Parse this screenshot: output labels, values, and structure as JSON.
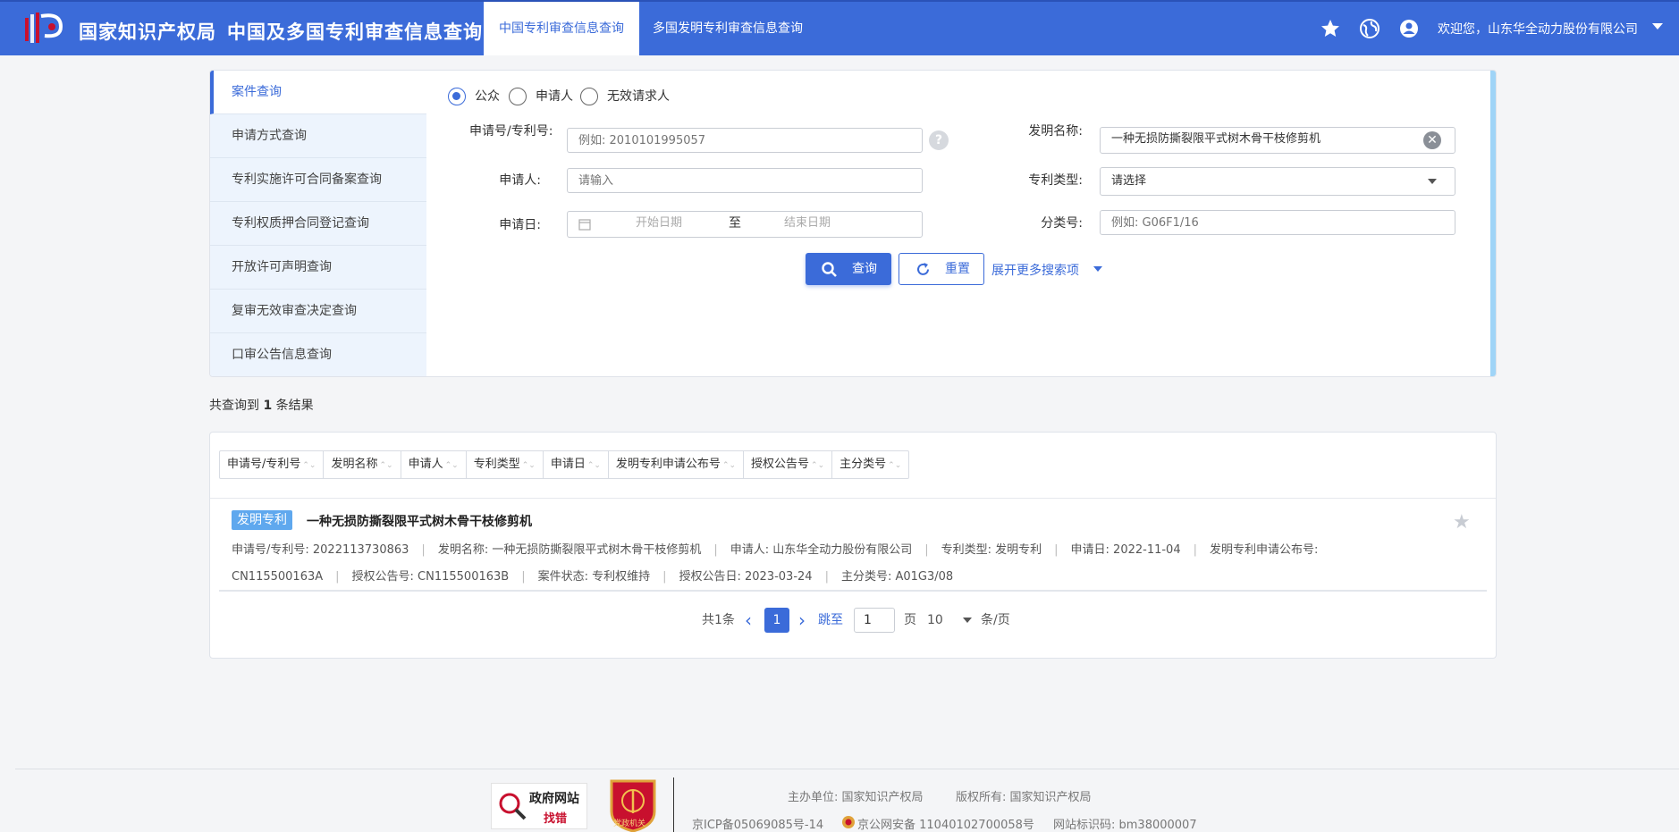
{
  "header": {
    "brand": "国家知识产权局",
    "site_title": "中国及多国专利审查信息查询",
    "tabs": [
      "中国专利审查信息查询",
      "多国发明专利审查信息查询"
    ],
    "welcome": "欢迎您，山东华全动力股份有限公司",
    "icons": [
      "star-icon",
      "globe-icon",
      "user-icon"
    ]
  },
  "sidenav": {
    "items": [
      "案件查询",
      "申请方式查询",
      "专利实施许可合同备案查询",
      "专利权质押合同登记查询",
      "开放许可声明查询",
      "复审无效审查决定查询",
      "口审公告信息查询"
    ]
  },
  "radios": {
    "options": [
      "公众",
      "申请人",
      "无效请求人"
    ],
    "selected": "公众"
  },
  "form": {
    "app_no_label": "申请号/专利号:",
    "app_no_placeholder": "例如: 2010101995057",
    "help": "?",
    "applicant_label": "申请人:",
    "applicant_placeholder": "请输入",
    "date_label": "申请日:",
    "date_start": "开始日期",
    "date_to": "至",
    "date_end": "结束日期",
    "title_label": "发明名称:",
    "title_value": "一种无损防撕裂限平式树木骨干枝修剪机",
    "clear": "✕",
    "type_label": "专利类型:",
    "type_value": "请选择",
    "class_label": "分类号:",
    "class_placeholder": "例如: G06F1/16",
    "search_btn": "查询",
    "reset_btn": "重置",
    "expand": "展开更多搜索项"
  },
  "results": {
    "count_prefix": "共查询到",
    "count": "1",
    "count_suffix": "条结果",
    "sort_columns": [
      "申请号/专利号",
      "发明名称",
      "申请人",
      "专利类型",
      "申请日",
      "发明专利申请公布号",
      "授权公告号",
      "主分类号"
    ],
    "sort_arrow": "⌃⌄",
    "item": {
      "tag": "发明专利",
      "title": "一种无损防撕裂限平式树木骨干枝修剪机",
      "star": "★",
      "line1": [
        "申请号/专利号:  2022113730863",
        "发明名称: 一种无损防撕裂限平式树木骨干枝修剪机",
        "申请人: 山东华全动力股份有限公司",
        "专利类型: 发明专利",
        "申请日: 2022-11-04",
        "发明专利申请公布号:"
      ],
      "line2": [
        "CN115500163A",
        "授权公告号: CN115500163B",
        "案件状态: 专利权维持",
        "授权公告日: 2023-03-24",
        "主分类号: A01G3/08"
      ]
    },
    "pager": {
      "total": "共1条",
      "prev": "‹",
      "page": "1",
      "next": "›",
      "jump": "跳至",
      "jump_value": "1",
      "page_unit": "页",
      "per_page": "10",
      "per_unit": "条/页"
    }
  },
  "footer": {
    "badge1_line1": "政府网站",
    "badge1_line2": "找错",
    "badge2_text": "党政机关",
    "host": "主办单位: 国家知识产权局",
    "copyright": "版权所有: 国家知识产权局",
    "icp": "京ICP备05069085号-14",
    "police": "京公网安备 11040102700058号",
    "site_code": "网站标识码: bm38000007"
  },
  "colors": {
    "primary": "#3b6bd9",
    "tag": "#5fa8ee",
    "nav_bg": "#edf4fd"
  }
}
